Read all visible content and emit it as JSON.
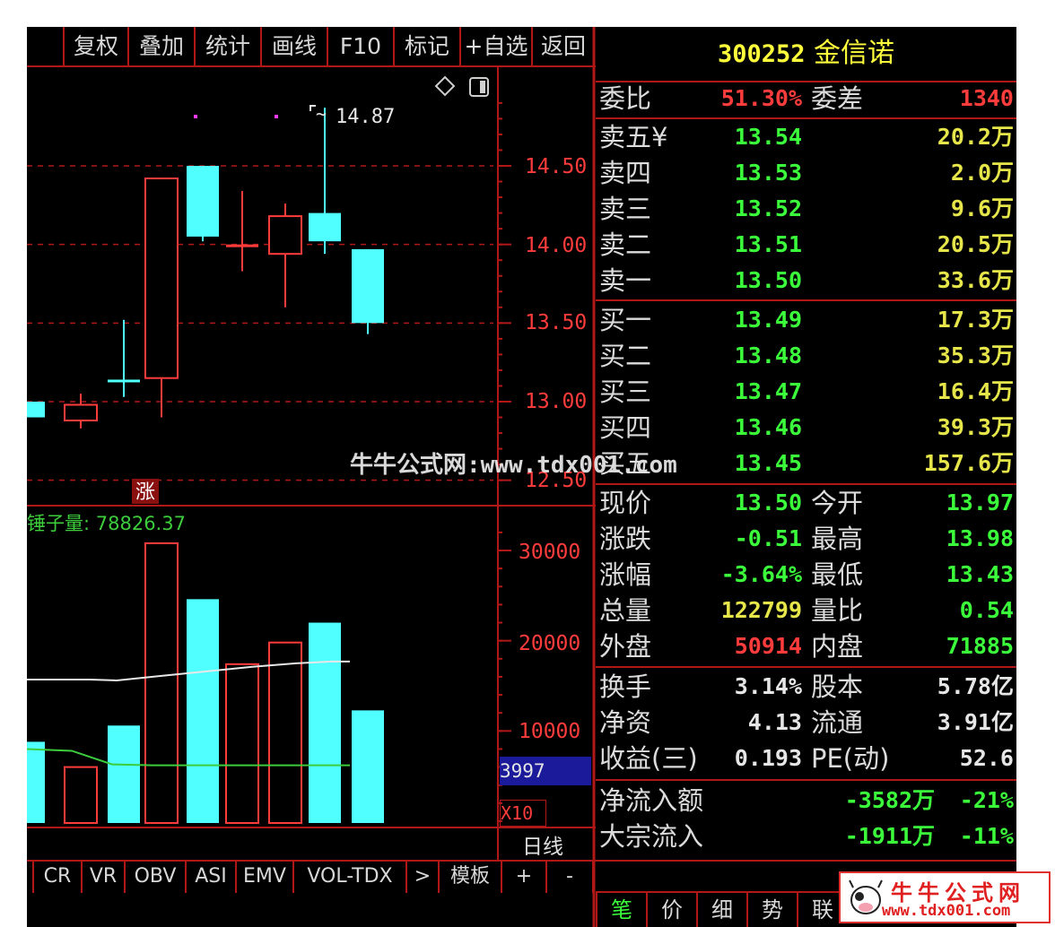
{
  "toolbar": {
    "items": [
      "复权",
      "叠加",
      "统计",
      "画线",
      "F10",
      "标记",
      "+自选",
      "返回"
    ]
  },
  "stock": {
    "code": "300252",
    "name": "金信诺"
  },
  "weibi": {
    "label1": "委比",
    "value1": "51.30%",
    "label2": "委差",
    "value2": "1340"
  },
  "sell": [
    {
      "label": "卖五¥",
      "price": "13.54",
      "vol": "20.2万"
    },
    {
      "label": "卖四",
      "price": "13.53",
      "vol": "2.0万"
    },
    {
      "label": "卖三",
      "price": "13.52",
      "vol": "9.6万"
    },
    {
      "label": "卖二",
      "price": "13.51",
      "vol": "20.5万"
    },
    {
      "label": "卖一",
      "price": "13.50",
      "vol": "33.6万"
    }
  ],
  "buy": [
    {
      "label": "买一",
      "price": "13.49",
      "vol": "17.3万"
    },
    {
      "label": "买二",
      "price": "13.48",
      "vol": "35.3万"
    },
    {
      "label": "买三",
      "price": "13.47",
      "vol": "16.4万"
    },
    {
      "label": "买四",
      "price": "13.46",
      "vol": "39.3万"
    },
    {
      "label": "买五",
      "price": "13.45",
      "vol": "157.6万"
    }
  ],
  "quote": [
    {
      "l1": "现价",
      "v1": "13.50",
      "c1": "green",
      "l2": "今开",
      "v2": "13.97",
      "c2": "green"
    },
    {
      "l1": "涨跌",
      "v1": "-0.51",
      "c1": "green",
      "l2": "最高",
      "v2": "13.98",
      "c2": "green"
    },
    {
      "l1": "涨幅",
      "v1": "-3.64%",
      "c1": "green",
      "l2": "最低",
      "v2": "13.43",
      "c2": "green"
    },
    {
      "l1": "总量",
      "v1": "122799",
      "c1": "yellow",
      "l2": "量比",
      "v2": "0.54",
      "c2": "green"
    },
    {
      "l1": "外盘",
      "v1": "50914",
      "c1": "red",
      "l2": "内盘",
      "v2": "71885",
      "c2": "green"
    }
  ],
  "fundamentals": [
    {
      "l1": "换手",
      "v1": "3.14%",
      "l2": "股本",
      "v2": "5.78亿"
    },
    {
      "l1": "净资",
      "v1": "4.13",
      "l2": "流通",
      "v2": "3.91亿"
    },
    {
      "l1": "收益(三)",
      "v1": "0.193",
      "l2": "PE(动)",
      "v2": "52.6"
    }
  ],
  "flow": [
    {
      "label": "净流入额",
      "amount": "-3582万",
      "pct": "-21%"
    },
    {
      "label": "大宗流入",
      "amount": "-1911万",
      "pct": "-11%"
    }
  ],
  "bottom_tabs": [
    "笔",
    "价",
    "细",
    "势",
    "联"
  ],
  "indicator_tabs": [
    "CR",
    "VR",
    "OBV",
    "ASI",
    "EMV",
    "VOL-TDX",
    ">",
    "模板",
    "+",
    "-"
  ],
  "price_chart": {
    "axis_labels": [
      "14.50",
      "14.00",
      "13.50",
      "13.00",
      "12.50"
    ],
    "high_label": "14.87",
    "zhang_label": "涨",
    "watermark": "牛牛公式网:www.tdx001.com"
  },
  "volume_chart": {
    "indicator_label": "锤子量: 78826.37",
    "axis_labels": [
      "30000",
      "20000",
      "10000"
    ],
    "current_value": "3997",
    "multiplier": "X10",
    "period": "日线"
  },
  "chart_data": [
    {
      "type": "candlestick",
      "ylim": [
        12.5,
        15.0
      ],
      "candles": [
        {
          "o": 13.0,
          "c": 12.9,
          "h": 13.0,
          "l": 12.9,
          "dir": "down"
        },
        {
          "o": 12.88,
          "c": 12.98,
          "h": 13.05,
          "l": 12.83,
          "dir": "up"
        },
        {
          "o": 13.14,
          "c": 13.14,
          "h": 13.52,
          "l": 13.03,
          "dir": "down"
        },
        {
          "o": 13.15,
          "c": 14.42,
          "h": 14.42,
          "l": 12.9,
          "dir": "up"
        },
        {
          "o": 14.5,
          "c": 14.05,
          "h": 14.5,
          "l": 14.02,
          "dir": "down"
        },
        {
          "o": 14.0,
          "c": 14.0,
          "h": 14.34,
          "l": 13.83,
          "dir": "flat"
        },
        {
          "o": 13.94,
          "c": 14.18,
          "h": 14.26,
          "l": 13.6,
          "dir": "up"
        },
        {
          "o": 14.2,
          "c": 14.02,
          "h": 14.87,
          "l": 13.94,
          "dir": "down"
        },
        {
          "o": 13.97,
          "c": 13.5,
          "h": 13.97,
          "l": 13.43,
          "dir": "down"
        }
      ]
    },
    {
      "type": "bar",
      "ylim": [
        0,
        32000
      ],
      "values": [
        8800,
        6000,
        10600,
        30800,
        24600,
        17400,
        19800,
        22000,
        12280
      ],
      "dirs": [
        "down",
        "up",
        "down",
        "up",
        "down",
        "up",
        "up",
        "down",
        "down"
      ],
      "ma_long": [
        8000,
        7800,
        6300,
        6200,
        6200,
        6200,
        6200,
        6200,
        6200
      ],
      "ma_short": [
        15700,
        15700,
        15600,
        16100,
        16600,
        17100,
        17500,
        17700,
        17700
      ]
    }
  ]
}
